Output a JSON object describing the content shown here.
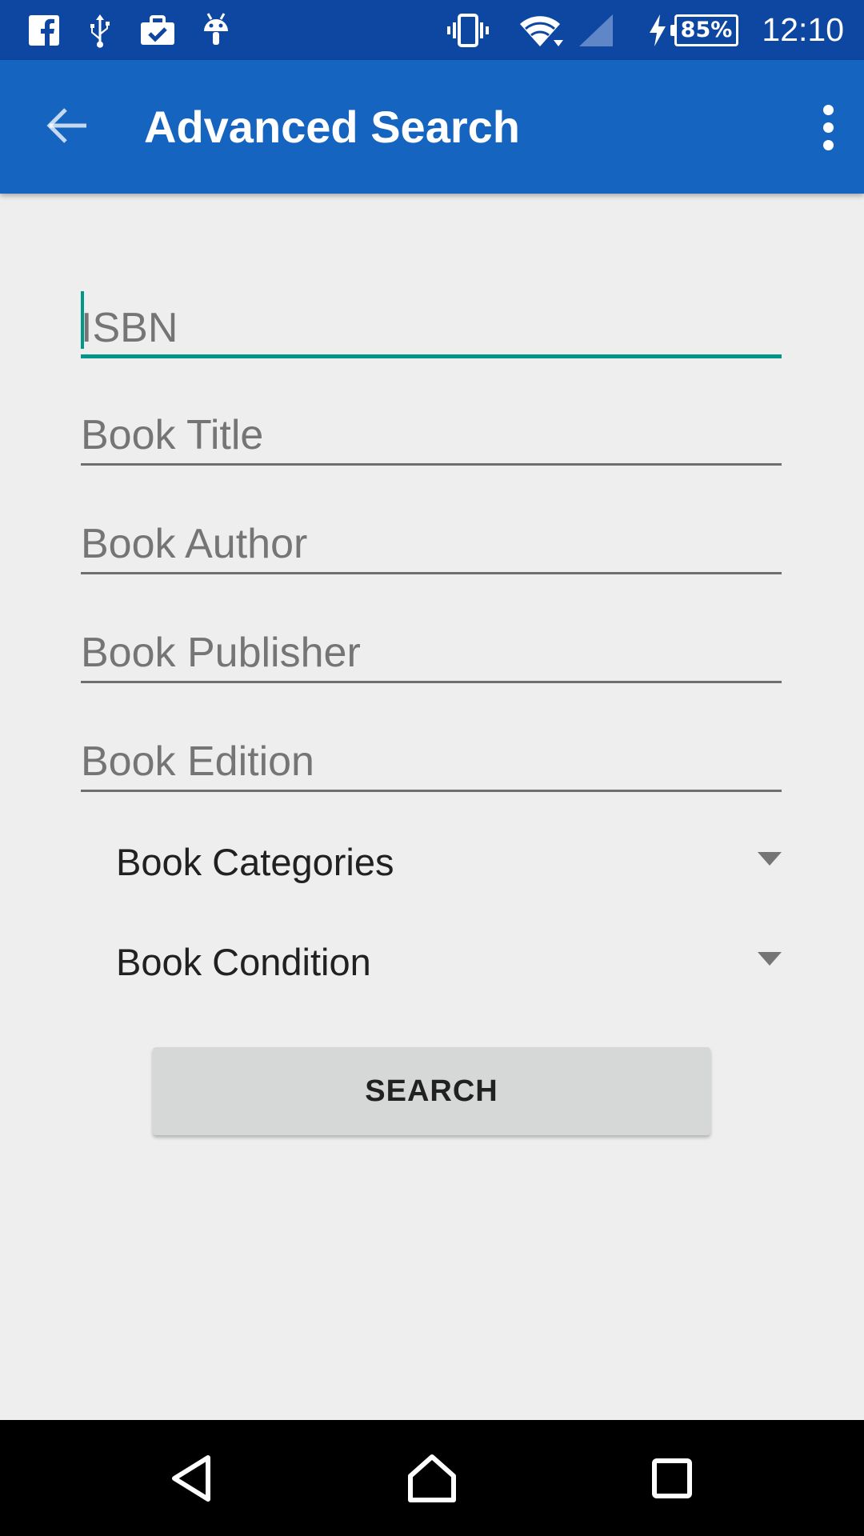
{
  "status_bar": {
    "time": "12:10",
    "battery": "85%",
    "icons": [
      "facebook-icon",
      "usb-icon",
      "clipboard-check-icon",
      "android-icon",
      "vibrate-icon",
      "wifi-icon",
      "signal-icon",
      "charging-icon",
      "battery-icon"
    ]
  },
  "app_bar": {
    "title": "Advanced Search",
    "back_icon": "arrow-back-icon",
    "overflow_icon": "more-vert-icon"
  },
  "form": {
    "fields": [
      {
        "placeholder": "ISBN",
        "value": "",
        "focused": true
      },
      {
        "placeholder": "Book Title",
        "value": ""
      },
      {
        "placeholder": "Book Author",
        "value": ""
      },
      {
        "placeholder": "Book Publisher",
        "value": ""
      },
      {
        "placeholder": "Book Edition",
        "value": ""
      }
    ],
    "spinners": [
      {
        "label": "Book Categories"
      },
      {
        "label": "Book Condition"
      }
    ],
    "search_label": "SEARCH"
  },
  "nav_bar": {
    "icons": [
      "nav-back-icon",
      "nav-home-icon",
      "nav-recents-icon"
    ]
  },
  "colors": {
    "status_bar": "#0d47a1",
    "app_bar": "#1565c0",
    "accent": "#009688",
    "background": "#eeeeee"
  }
}
